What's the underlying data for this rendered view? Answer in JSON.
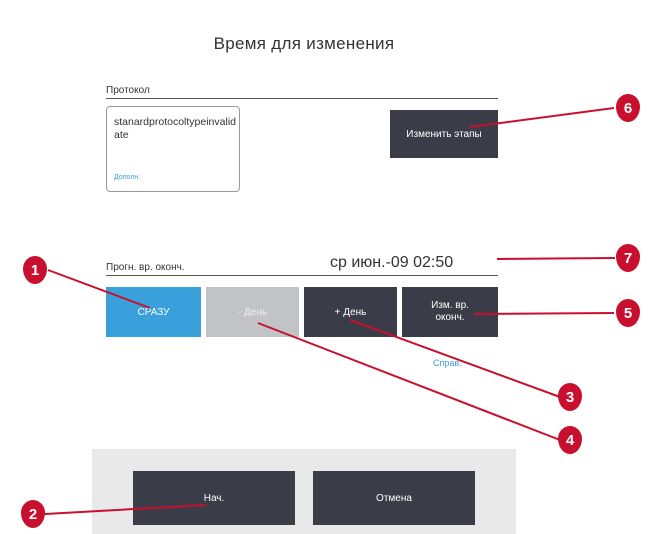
{
  "dialog": {
    "title": "Время для изменения"
  },
  "protocol": {
    "section_label": "Протокол",
    "name": "stanardprotocoltypeinvalidate",
    "status": "Дополн."
  },
  "buttons": {
    "change_steps": "Изменить этапы",
    "asap": "СРАЗУ",
    "minus_day": "- День",
    "plus_day": "+ День",
    "change_end_time": "Изм. вр. оконч.",
    "start": "Нач.",
    "cancel": "Отмена"
  },
  "end_time": {
    "label": "Прогн. вр. оконч.",
    "value": "ср июн.-09 02:50"
  },
  "links": {
    "reference": "Справ."
  },
  "callouts": [
    "1",
    "2",
    "3",
    "4",
    "5",
    "6",
    "7"
  ],
  "colors": {
    "accent_blue": "#3aa0dc",
    "dark_button": "#3a3d48",
    "disabled_button": "#c2c3c7",
    "callout_red": "#c8102e"
  }
}
